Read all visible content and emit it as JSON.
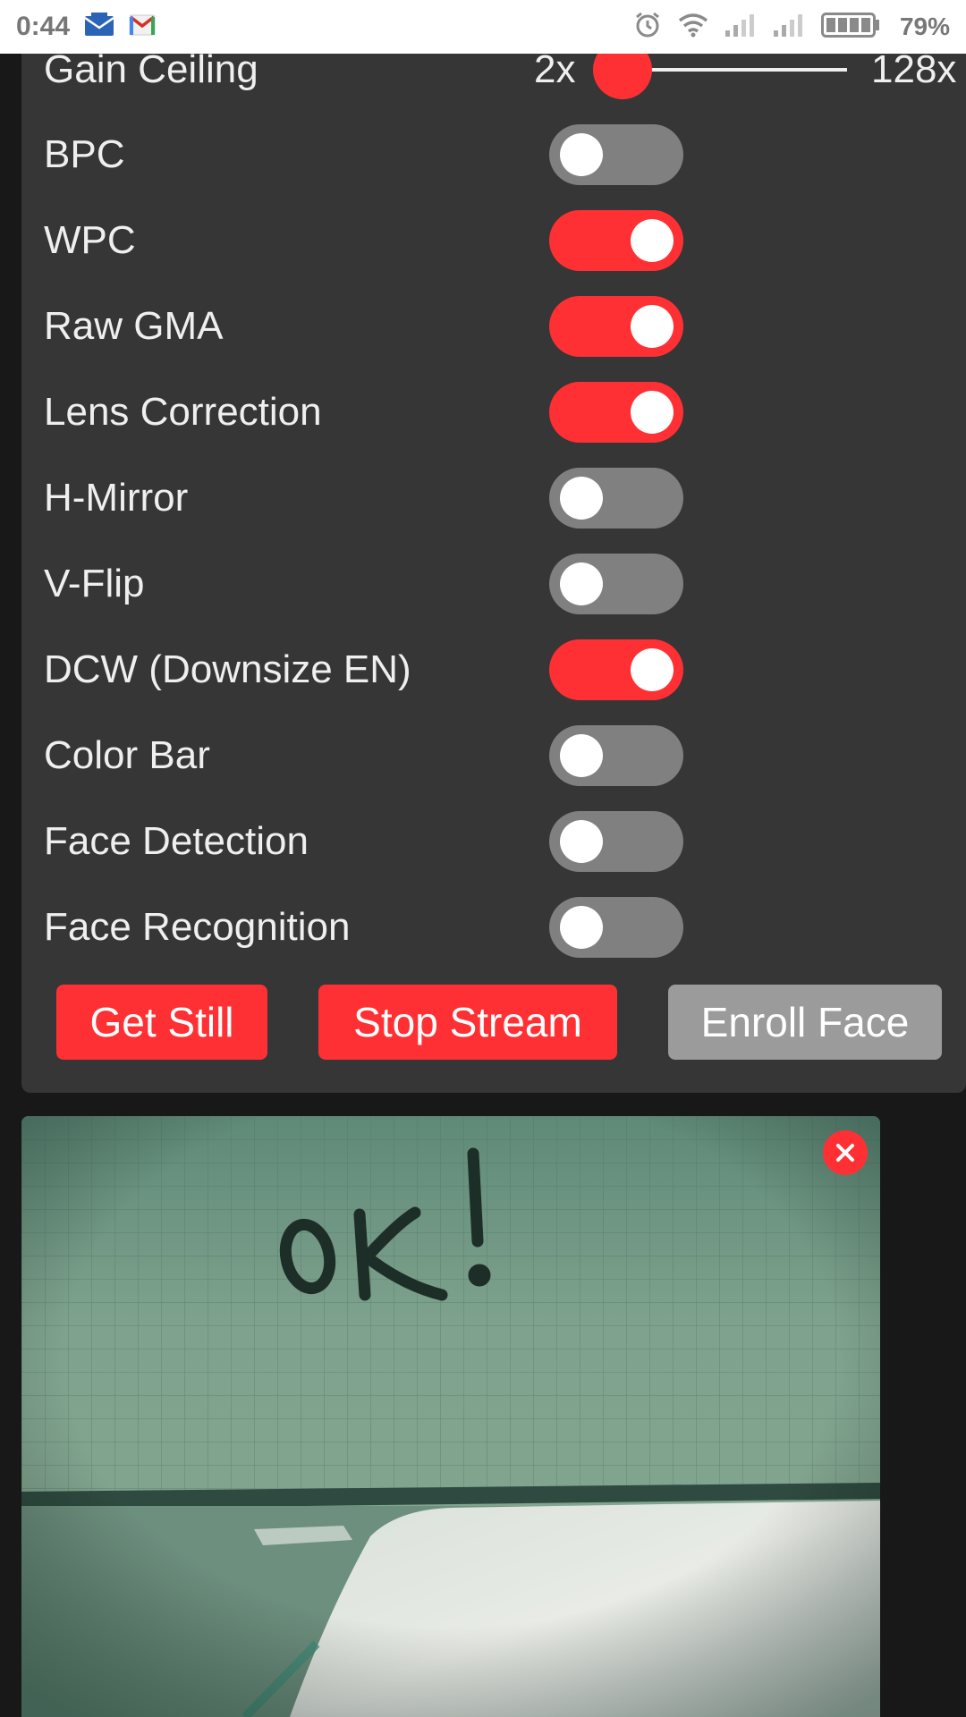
{
  "status_bar": {
    "time": "0:44",
    "battery_text": "79%",
    "icons": [
      "mail-icon",
      "gmail-icon",
      "alarm-icon",
      "wifi-icon",
      "signal-icon",
      "signal-icon-2",
      "battery-icon"
    ]
  },
  "gain_ceiling": {
    "label": "Gain Ceiling",
    "min_label": "2x",
    "max_label": "128x",
    "value_fraction": 0
  },
  "toggles": [
    {
      "label": "BPC",
      "on": false
    },
    {
      "label": "WPC",
      "on": true
    },
    {
      "label": "Raw GMA",
      "on": true
    },
    {
      "label": "Lens Correction",
      "on": true
    },
    {
      "label": "H-Mirror",
      "on": false
    },
    {
      "label": "V-Flip",
      "on": false
    },
    {
      "label": "DCW (Downsize EN)",
      "on": true
    },
    {
      "label": "Color Bar",
      "on": false
    },
    {
      "label": "Face Detection",
      "on": false
    },
    {
      "label": "Face Recognition",
      "on": false
    }
  ],
  "buttons": {
    "get_still": "Get Still",
    "stop_stream": "Stop Stream",
    "enroll_face": "Enroll Face"
  },
  "colors": {
    "accent": "#ff3034",
    "panel": "#363636",
    "background": "#181818",
    "toggle_off": "#808080",
    "button_disabled": "#9b9b9b"
  },
  "stream": {
    "handwritten_text": "OK!"
  }
}
